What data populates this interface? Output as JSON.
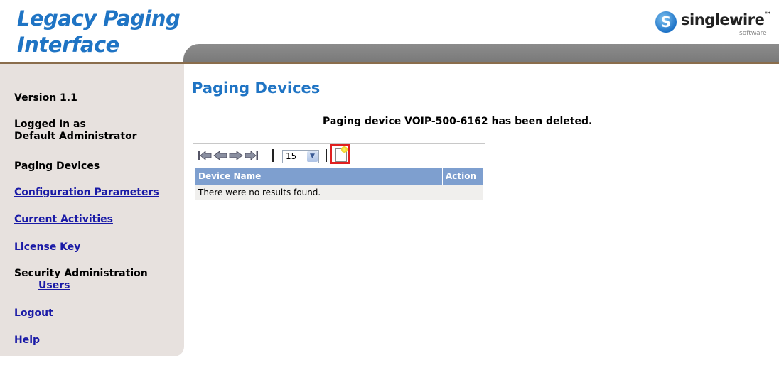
{
  "header": {
    "app_title_line1": "Legacy Paging",
    "app_title_line2": "Interface",
    "brand_name": "singlewire",
    "brand_mark": "S",
    "brand_tm": "™",
    "brand_sub": "software"
  },
  "sidebar": {
    "version": "Version 1.1",
    "logged_in_label": "Logged In as",
    "logged_in_user": "Default Administrator",
    "items": [
      {
        "label": "Paging Devices"
      },
      {
        "label": "Configuration Parameters"
      },
      {
        "label": "Current Activities"
      },
      {
        "label": "License Key"
      },
      {
        "label": "Security Administration"
      },
      {
        "label": "Users"
      },
      {
        "label": "Logout"
      },
      {
        "label": "Help"
      }
    ]
  },
  "main": {
    "title": "Paging Devices",
    "status_message": "Paging device VOIP-500-6162 has been deleted.",
    "toolbar": {
      "icons": [
        "first-page-icon",
        "previous-page-icon",
        "next-page-icon",
        "last-page-icon",
        "add-new-icon"
      ],
      "page_size": "15"
    },
    "table": {
      "columns": [
        "Device Name",
        "Action"
      ],
      "empty_message": "There were no results found."
    }
  },
  "colors": {
    "accent_blue": "#1f74c4",
    "sidebar_bg": "#e7e1de",
    "table_header_bg": "#7e9fcf",
    "link": "#1a1aa6",
    "highlight_border": "#e02020"
  }
}
